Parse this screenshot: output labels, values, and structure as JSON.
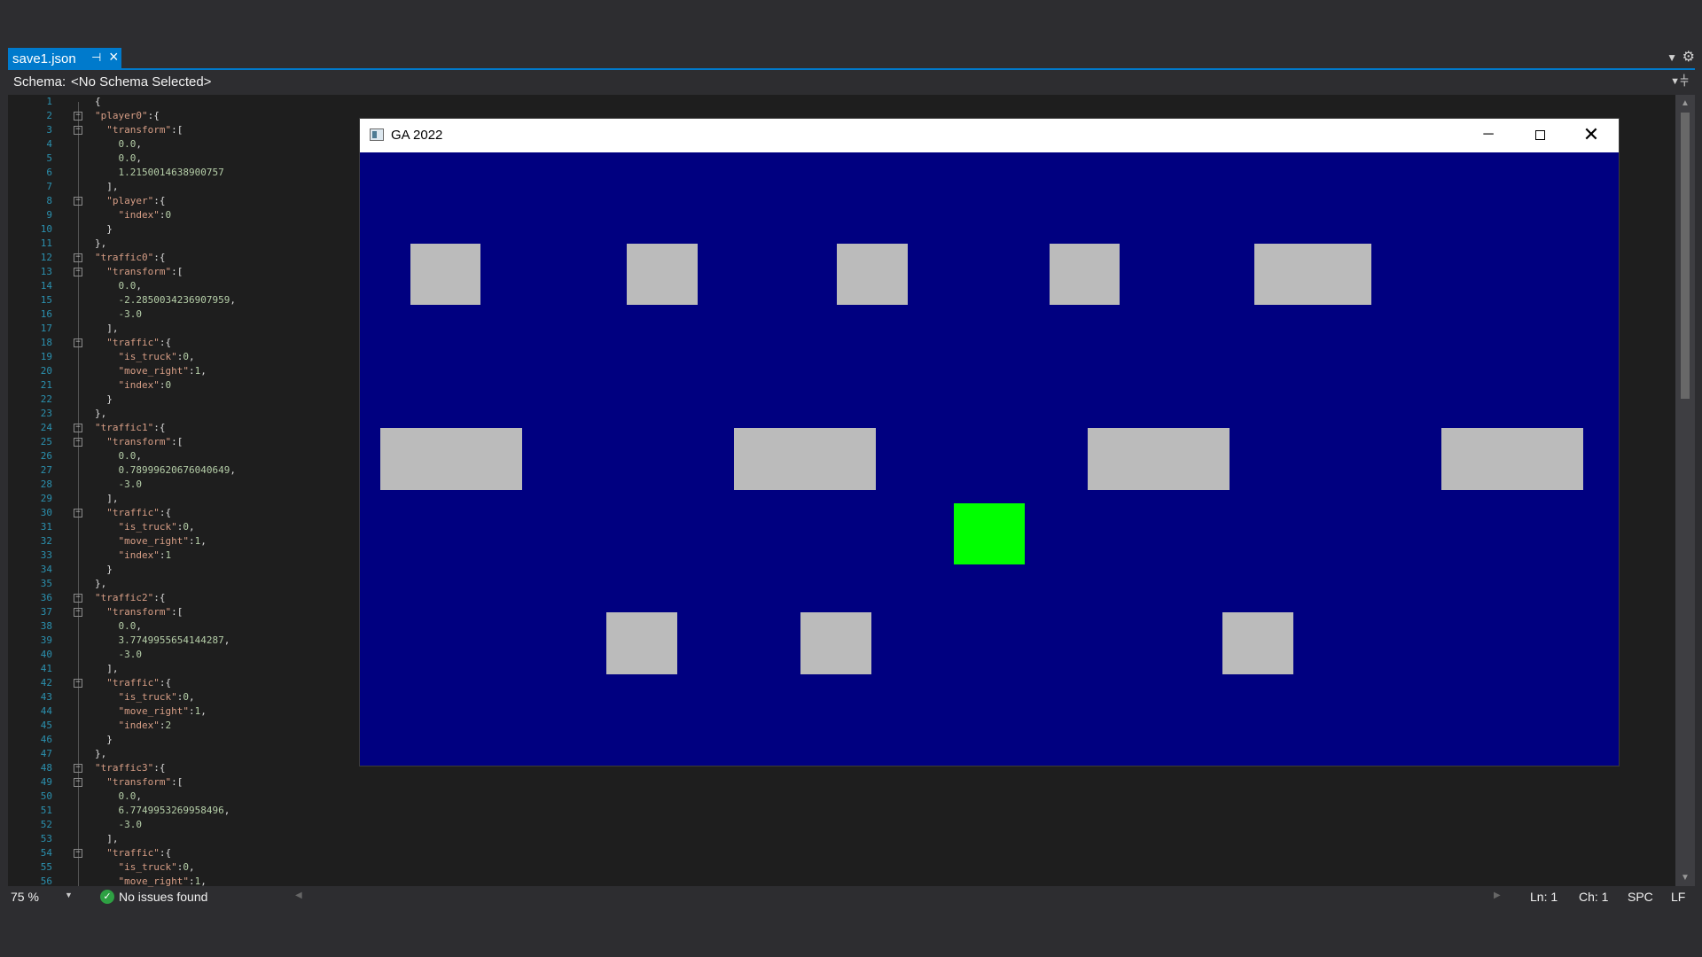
{
  "tabs": {
    "active": {
      "label": "save1.json",
      "pin_icon": "pin-icon",
      "close_icon": "close-icon"
    }
  },
  "schema": {
    "label": "Schema:",
    "value": "<No Schema Selected>"
  },
  "editor": {
    "lines": [
      {
        "n": "1",
        "fold": "",
        "text": "{"
      },
      {
        "n": "2",
        "fold": "⊟",
        "text": "\"player0\":{"
      },
      {
        "n": "3",
        "fold": "⊟",
        "text": "  \"transform\":["
      },
      {
        "n": "4",
        "fold": "",
        "text": "    0.0,"
      },
      {
        "n": "5",
        "fold": "",
        "text": "    0.0,"
      },
      {
        "n": "6",
        "fold": "",
        "text": "    1.2150014638900757"
      },
      {
        "n": "7",
        "fold": "",
        "text": "  ],"
      },
      {
        "n": "8",
        "fold": "⊟",
        "text": "  \"player\":{"
      },
      {
        "n": "9",
        "fold": "",
        "text": "    \"index\":0"
      },
      {
        "n": "10",
        "fold": "",
        "text": "  }"
      },
      {
        "n": "11",
        "fold": "",
        "text": "},"
      },
      {
        "n": "12",
        "fold": "⊟",
        "text": "\"traffic0\":{"
      },
      {
        "n": "13",
        "fold": "⊟",
        "text": "  \"transform\":["
      },
      {
        "n": "14",
        "fold": "",
        "text": "    0.0,"
      },
      {
        "n": "15",
        "fold": "",
        "text": "    -2.2850034236907959,"
      },
      {
        "n": "16",
        "fold": "",
        "text": "    -3.0"
      },
      {
        "n": "17",
        "fold": "",
        "text": "  ],"
      },
      {
        "n": "18",
        "fold": "⊟",
        "text": "  \"traffic\":{"
      },
      {
        "n": "19",
        "fold": "",
        "text": "    \"is_truck\":0,"
      },
      {
        "n": "20",
        "fold": "",
        "text": "    \"move_right\":1,"
      },
      {
        "n": "21",
        "fold": "",
        "text": "    \"index\":0"
      },
      {
        "n": "22",
        "fold": "",
        "text": "  }"
      },
      {
        "n": "23",
        "fold": "",
        "text": "},"
      },
      {
        "n": "24",
        "fold": "⊟",
        "text": "\"traffic1\":{"
      },
      {
        "n": "25",
        "fold": "⊟",
        "text": "  \"transform\":["
      },
      {
        "n": "26",
        "fold": "",
        "text": "    0.0,"
      },
      {
        "n": "27",
        "fold": "",
        "text": "    0.78999620676040649,"
      },
      {
        "n": "28",
        "fold": "",
        "text": "    -3.0"
      },
      {
        "n": "29",
        "fold": "",
        "text": "  ],"
      },
      {
        "n": "30",
        "fold": "⊟",
        "text": "  \"traffic\":{"
      },
      {
        "n": "31",
        "fold": "",
        "text": "    \"is_truck\":0,"
      },
      {
        "n": "32",
        "fold": "",
        "text": "    \"move_right\":1,"
      },
      {
        "n": "33",
        "fold": "",
        "text": "    \"index\":1"
      },
      {
        "n": "34",
        "fold": "",
        "text": "  }"
      },
      {
        "n": "35",
        "fold": "",
        "text": "},"
      },
      {
        "n": "36",
        "fold": "⊟",
        "text": "\"traffic2\":{"
      },
      {
        "n": "37",
        "fold": "⊟",
        "text": "  \"transform\":["
      },
      {
        "n": "38",
        "fold": "",
        "text": "    0.0,"
      },
      {
        "n": "39",
        "fold": "",
        "text": "    3.7749955654144287,"
      },
      {
        "n": "40",
        "fold": "",
        "text": "    -3.0"
      },
      {
        "n": "41",
        "fold": "",
        "text": "  ],"
      },
      {
        "n": "42",
        "fold": "⊟",
        "text": "  \"traffic\":{"
      },
      {
        "n": "43",
        "fold": "",
        "text": "    \"is_truck\":0,"
      },
      {
        "n": "44",
        "fold": "",
        "text": "    \"move_right\":1,"
      },
      {
        "n": "45",
        "fold": "",
        "text": "    \"index\":2"
      },
      {
        "n": "46",
        "fold": "",
        "text": "  }"
      },
      {
        "n": "47",
        "fold": "",
        "text": "},"
      },
      {
        "n": "48",
        "fold": "⊟",
        "text": "\"traffic3\":{"
      },
      {
        "n": "49",
        "fold": "⊟",
        "text": "  \"transform\":["
      },
      {
        "n": "50",
        "fold": "",
        "text": "    0.0,"
      },
      {
        "n": "51",
        "fold": "",
        "text": "    6.7749953269958496,"
      },
      {
        "n": "52",
        "fold": "",
        "text": "    -3.0"
      },
      {
        "n": "53",
        "fold": "",
        "text": "  ],"
      },
      {
        "n": "54",
        "fold": "⊟",
        "text": "  \"traffic\":{"
      },
      {
        "n": "55",
        "fold": "",
        "text": "    \"is_truck\":0,"
      },
      {
        "n": "56",
        "fold": "",
        "text": "    \"move_right\":1,"
      }
    ]
  },
  "statusbar": {
    "zoom": "75 %",
    "issues": "No issues found",
    "ln": "Ln: 1",
    "ch": "Ch: 1",
    "spc": "SPC",
    "lf": "LF"
  },
  "game_window": {
    "title": "GA 2022",
    "background_color": "#000080",
    "block_color": "#bbbbbb",
    "player_color": "#00ff00"
  },
  "colors": {
    "accent": "#007acc",
    "editor_bg": "#1e1e1e",
    "chrome_bg": "#2d2d30",
    "line_number": "#2b91af",
    "json_key": "#d69d85",
    "json_number": "#b5cea8"
  }
}
